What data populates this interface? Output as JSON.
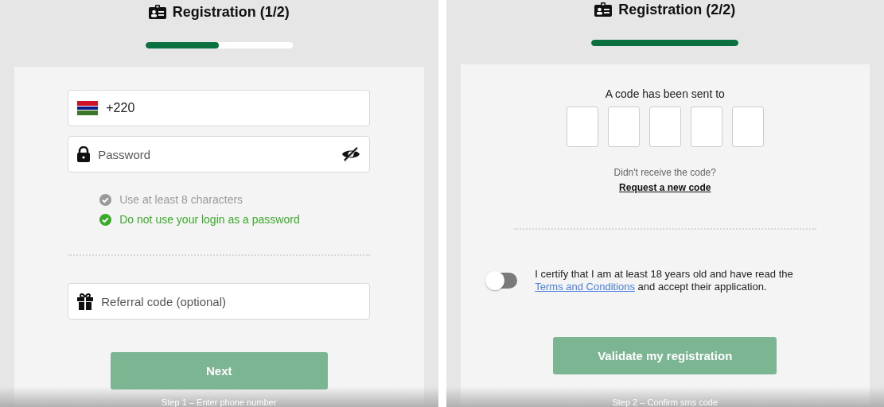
{
  "panels": [
    {
      "title": "Registration (1/2)",
      "progress": {
        "level": 0.5
      },
      "sections": [
        {
          "kind": "phone",
          "value": "+220"
        },
        {
          "kind": "password",
          "placeholder": "Password"
        },
        {
          "kind": "rules",
          "items": [
            {
              "text": "Use at least 8 characters",
              "met": false
            },
            {
              "text": "Do not use your login as a password",
              "met": true
            }
          ]
        },
        {
          "kind": "divider"
        },
        {
          "kind": "referral",
          "placeholder": "Referral code (optional)"
        },
        {
          "kind": "button",
          "label": "Next",
          "disabled": true
        }
      ],
      "caption": "Step 1 – Enter phone number"
    },
    {
      "title": "Registration (2/2)",
      "progress": {
        "level": 1
      },
      "sections": [
        {
          "kind": "code",
          "prompt": "A code has been sent to",
          "boxes": [
            {
              "filled": false
            },
            {
              "filled": false
            },
            {
              "filled": false
            },
            {
              "filled": false
            },
            {
              "filled": false
            }
          ],
          "hint": "Didn't receive the code?",
          "link": "Request a new code"
        },
        {
          "kind": "divider"
        },
        {
          "kind": "certify",
          "on": false,
          "text": "I certify that I am at least 18 years old and have read the",
          "link": "Terms and Conditions",
          "after": "and accept their application."
        },
        {
          "kind": "button",
          "label": "Validate my registration",
          "disabled": true
        }
      ],
      "caption": "Step 2 – Confirm sms code"
    }
  ]
}
